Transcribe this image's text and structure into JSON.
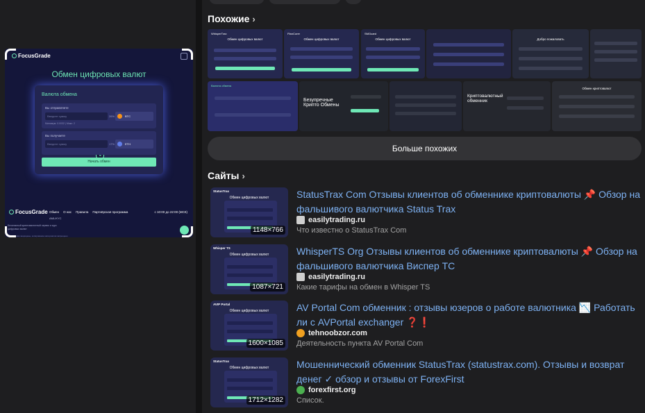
{
  "preview": {
    "logo": "FocusGrade",
    "title": "Обмен цифровых валют",
    "card_title": "Валюта обмена",
    "give_label": "Вы отправляете",
    "get_label": "Вы получаете",
    "placeholder": "Введите сумму",
    "give_pct": "26%",
    "get_pct": "17%",
    "give_currency": "BTC",
    "get_currency": "ETH",
    "minmax": "Минимум: 0.0032 | Макс: 2",
    "submit": "Начать обмен",
    "footer_logo": "FocusGrade",
    "footer_nav": [
      "Обмен",
      "О нас",
      "Правила",
      "Партнёрская программа"
    ],
    "footer_sub": "AML/KYC",
    "footer_time": "с 10:00 до 22:00 (МСК)",
    "footer_text": "Безопасный криптовалютный сервис и курс цифровых валют",
    "footer_copy": "© Все права защищены, копирование материалов запрещено"
  },
  "similar": {
    "heading": "Похожие",
    "more_label": "Больше похожих",
    "thumbs": [
      {
        "header": "WhisperTrax",
        "title": "Обмен цифровых валют"
      },
      {
        "header": "PlanCurer",
        "title": "Обмен цифровых валют"
      },
      {
        "header": "SMGuard",
        "title": "Обмен цифровых валют"
      },
      {
        "header": "",
        "title": ""
      },
      {
        "header": "",
        "title": "Добро пожаловать"
      },
      {
        "header": "",
        "title": ""
      },
      {
        "header": "Валюта обмена",
        "title": ""
      },
      {
        "header": "",
        "title": "Безупречные Крипто Обмены"
      },
      {
        "header": "",
        "title": ""
      },
      {
        "header": "",
        "title": "Криптовалютный обменник"
      },
      {
        "header": "",
        "title": "Обмен криптовалют"
      }
    ]
  },
  "sites": {
    "heading": "Сайты",
    "results": [
      {
        "title": "StatusTrax Com Отзывы клиентов об обменнике криптовалюты 📌 Обзор на фальшивого валютчика Status Trax",
        "source": "easilytrading.ru",
        "desc": "Что известно о StatusTrax Com",
        "dims": "1148×766",
        "thumb_logo": "StatusTrax",
        "thumb_title": "Обмен цифровых валют",
        "fav_color": "#cfcfcf"
      },
      {
        "title": "WhisperTS Org Отзывы клиентов об обменнике криптовалюты 📌 Обзор на фальшивого валютчика Виспер ТС",
        "source": "easilytrading.ru",
        "desc": "Какие тарифы на обмен в Whisper TS",
        "dims": "1087×721",
        "thumb_logo": "Whisper TS",
        "thumb_title": "Обмен цифровых валют",
        "fav_color": "#cfcfcf"
      },
      {
        "title": "AV Portal Com обменник : отзывы юзеров о работе валютника 📉 Работать ли с AVPortal exchanger ❓❗",
        "source": "tehnoobzor.com",
        "desc": "Деятельность пункта AV Portal Com",
        "dims": "1600×1085",
        "thumb_logo": "AVIP Portal",
        "thumb_title": "Обмен цифровых валют",
        "fav_color": "#f0a020"
      },
      {
        "title": "Мошеннический обменник StatusTrax (statustrax.com). Отзывы и возврат денег ✓ обзор и отзывы от ForexFirst",
        "source": "forexfirst.org",
        "desc": "Список.",
        "dims": "1712×1282",
        "thumb_logo": "StatusTrax",
        "thumb_title": "Обмен цифровых валют",
        "fav_color": "#4cb050"
      }
    ]
  }
}
